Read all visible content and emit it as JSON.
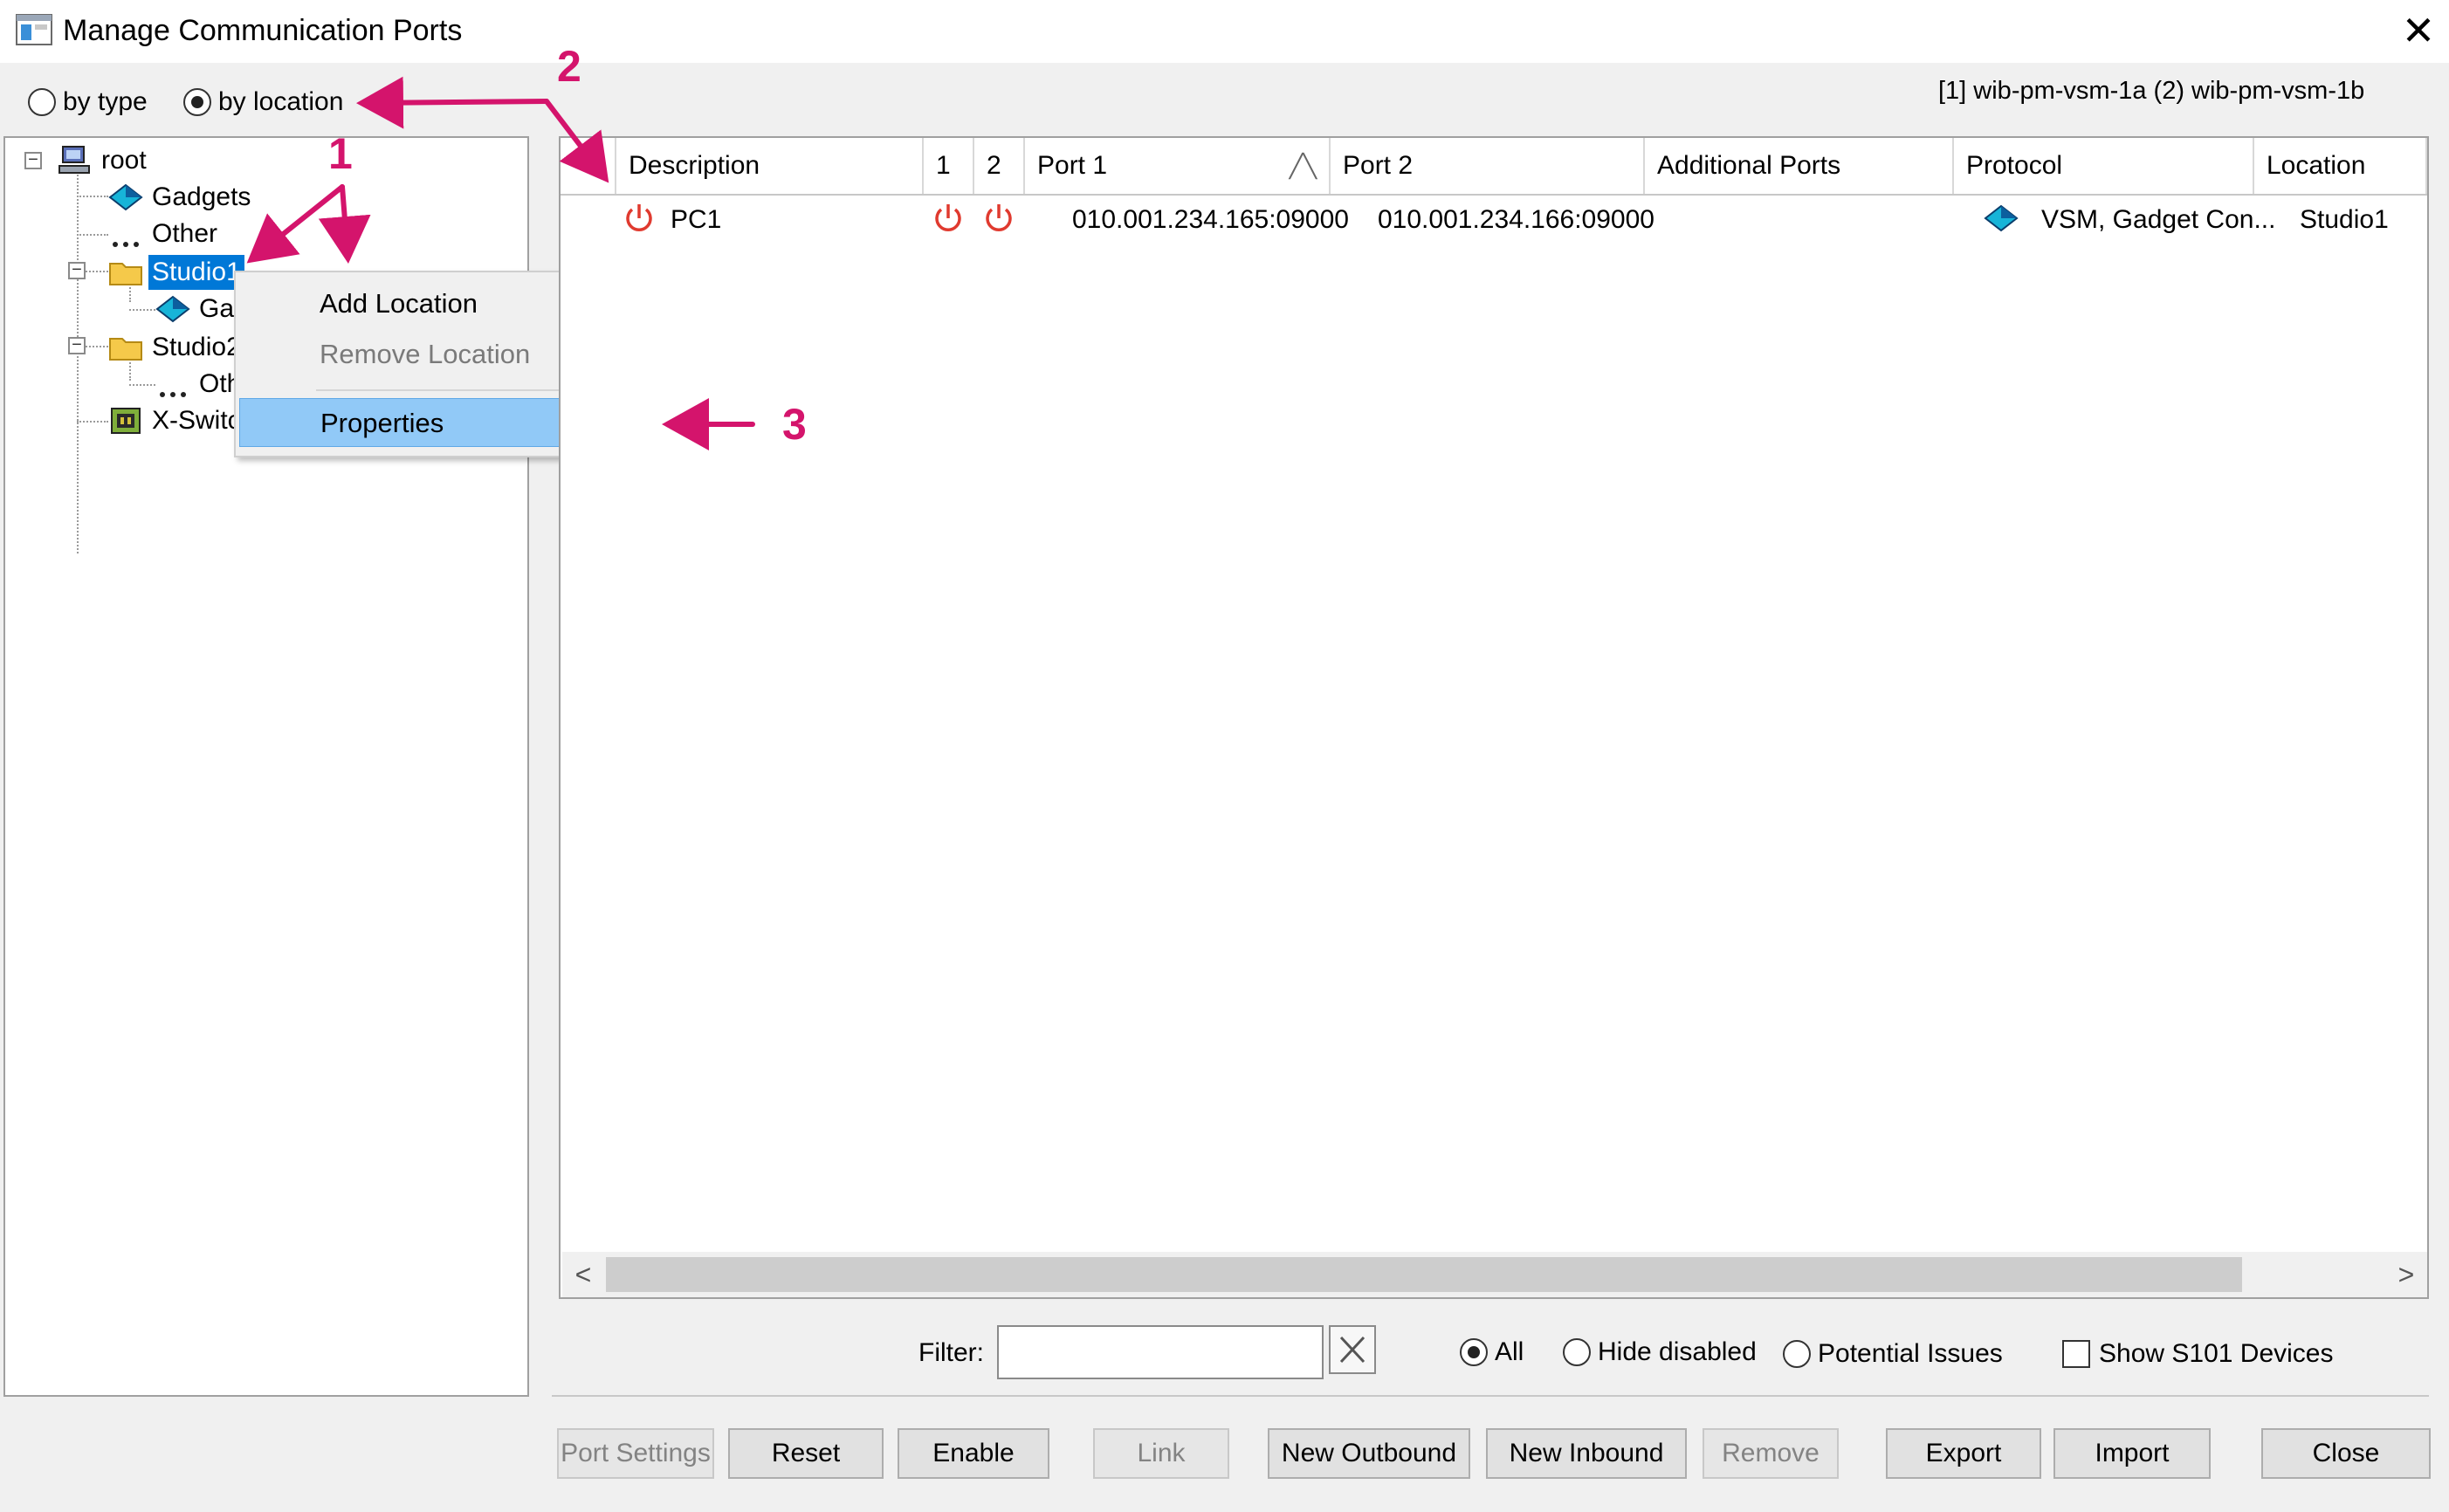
{
  "window": {
    "title": "Manage Communication Ports",
    "close_glyph": "✕"
  },
  "view_mode": {
    "options": [
      {
        "label": "by type",
        "selected": false
      },
      {
        "label": "by location",
        "selected": true
      }
    ]
  },
  "server_info": "[1] wib-pm-vsm-1a  (2) wib-pm-vsm-1b",
  "tree": {
    "nodes": [
      {
        "label": "root",
        "icon": "computer-icon"
      },
      {
        "label": "Gadgets",
        "icon": "gadget-icon"
      },
      {
        "label": "Other",
        "icon": "ellipsis-icon"
      },
      {
        "label": "Studio1",
        "icon": "folder-icon",
        "selected": true
      },
      {
        "label": "Gad",
        "icon": "gadget-icon"
      },
      {
        "label": "Studio2",
        "icon": "folder-icon"
      },
      {
        "label": "Oth",
        "icon": "ellipsis-icon"
      },
      {
        "label": "X-Switc",
        "icon": "xswitch-icon"
      }
    ]
  },
  "context_menu": {
    "items": [
      {
        "label": "Add Location",
        "enabled": true
      },
      {
        "label": "Remove Location",
        "enabled": false
      },
      {
        "label": "Properties",
        "enabled": true,
        "highlighted": true
      }
    ]
  },
  "grid": {
    "columns": [
      "",
      "Description",
      "1",
      "2",
      "Port 1",
      "Port 2",
      "Additional Ports",
      "Protocol",
      "Location"
    ],
    "sort_indicator": "╱╲",
    "rows": [
      {
        "description": "PC1",
        "port1": "010.001.234.165:09000",
        "port2": "010.001.234.166:09000",
        "additional_ports": "",
        "protocol": "VSM, Gadget Con...",
        "location": "Studio1"
      }
    ],
    "scroll_left": "<",
    "scroll_right": ">"
  },
  "filter": {
    "label": "Filter:",
    "value": "",
    "options": [
      {
        "label": "All",
        "selected": true
      },
      {
        "label": "Hide disabled",
        "selected": false
      },
      {
        "label": "Potential Issues",
        "selected": false
      }
    ],
    "show_s101_label": "Show S101 Devices"
  },
  "buttons": [
    {
      "label": "Port Settings",
      "enabled": false
    },
    {
      "label": "Reset",
      "enabled": true
    },
    {
      "label": "Enable",
      "enabled": true
    },
    {
      "label": "Link",
      "enabled": false
    },
    {
      "label": "New Outbound",
      "enabled": true
    },
    {
      "label": "New Inbound",
      "enabled": true
    },
    {
      "label": "Remove",
      "enabled": false
    },
    {
      "label": "Export",
      "enabled": true
    },
    {
      "label": "Import",
      "enabled": true
    },
    {
      "label": "Close",
      "enabled": true
    }
  ],
  "annotations": {
    "n1": "1",
    "n2": "2",
    "n3": "3",
    "color": "#d4146c"
  },
  "colors": {
    "selection": "#0078d7",
    "menu_highlight": "#91c9f7",
    "power_red": "#e03a2f"
  }
}
